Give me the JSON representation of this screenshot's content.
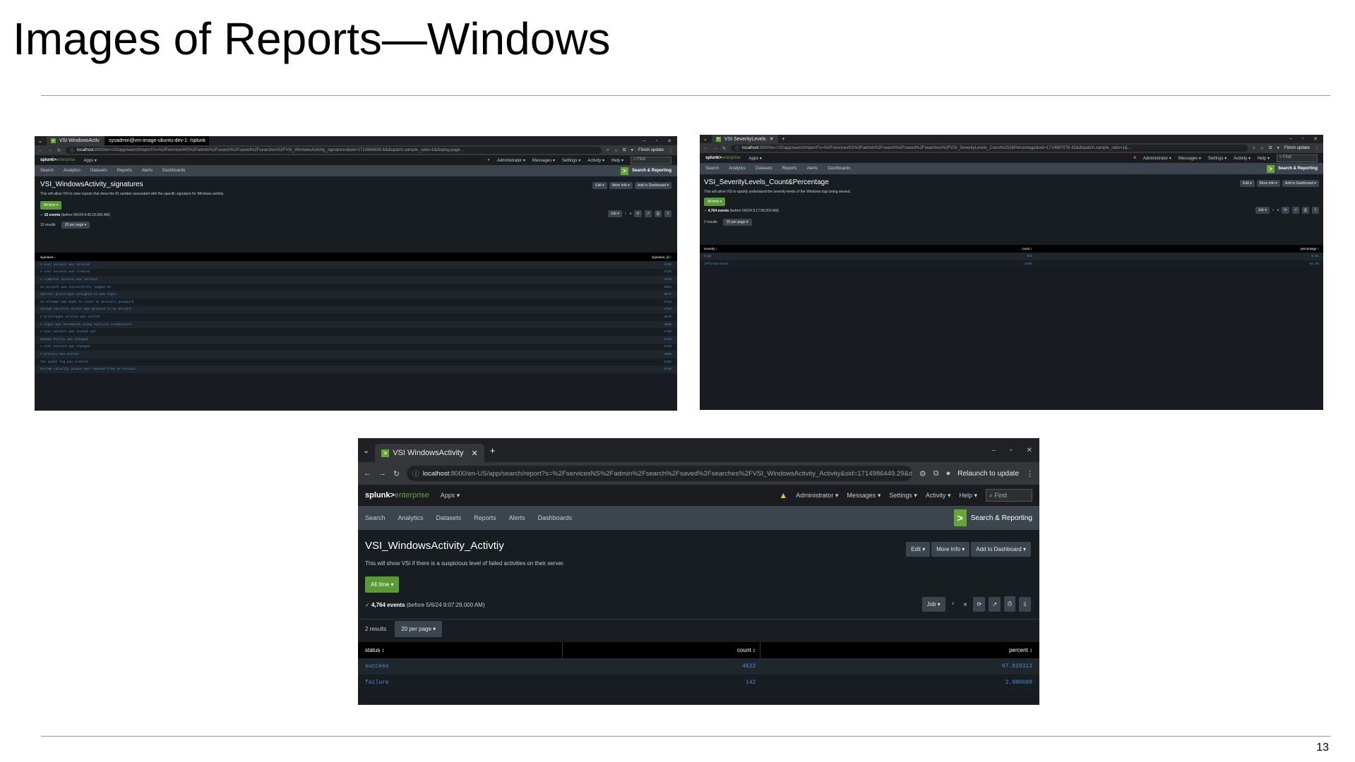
{
  "slide": {
    "title": "Images of Reports—Windows",
    "page_number": "13"
  },
  "common": {
    "finish_update": "Finish update",
    "relaunch": "Relaunch to update",
    "brand": "splunk>",
    "brand_suffix": "enterprise",
    "apps": "Apps ▾",
    "menu": [
      "Administrator ▾",
      "Messages ▾",
      "Settings ▾",
      "Activity ▾",
      "Help ▾"
    ],
    "find": "Find",
    "appnav": [
      "Search",
      "Analytics",
      "Datasets",
      "Reports",
      "Alerts",
      "Dashboards"
    ],
    "search_reporting": "Search & Reporting",
    "edit": "Edit ▾",
    "more_info": "More Info ▾",
    "add_dashboard": "Add to Dashboard ▾",
    "all_time": "All time ▾",
    "per_page": "20 per page ▾",
    "job": "Job ▾"
  },
  "shot1": {
    "tab": "VSI WindowsActiv",
    "tooltip": "sysadmin@vm-image-ubuntu-dev-1: /splunk",
    "url_host": "localhost",
    "url_rest": ":8000/en-US/app/search/report?s=%2FservicesNS%2Fadmin%2Fsearch%2Fsaved%2Fsearches%2FVSI_WindowsActivity_signatures&sid=1714984938.6&dispatch.sample_ratio=1&display.page...",
    "report_title": "VSI_WindowsActivity_signatures",
    "description": "This will allow VSI to view reports that show the ID number associated with the specific signature for Windows activity.",
    "events": "15 events",
    "events_suffix": "(before 5/6/24 8:42:18.000 AM)",
    "results": "15 results",
    "columns": [
      "signature ↕",
      "signature_id ↕"
    ],
    "rows": [
      [
        "A user account was deleted",
        "4726"
      ],
      [
        "A user account was created",
        "4720"
      ],
      [
        "A computer account was deleted",
        "4743"
      ],
      [
        "An account was successfully logged on",
        "4624"
      ],
      [
        "Special privileges assigned to new logon",
        "4672"
      ],
      [
        "An attempt was made to reset an accounts password",
        "4724"
      ],
      [
        "System security access was granted to an account",
        "4717"
      ],
      [
        "A privileged service was called",
        "4673"
      ],
      [
        "A logon was attempted using explicit credentials",
        "4648"
      ],
      [
        "A user account was locked out",
        "4740"
      ],
      [
        "Domain Policy was changed",
        "4739"
      ],
      [
        "A user account was changed",
        "4738"
      ],
      [
        "A process has exited",
        "4689"
      ],
      [
        "The audit log was cleared",
        "1102"
      ],
      [
        "System security access was removed from an account",
        "4718"
      ]
    ]
  },
  "shot2": {
    "tab": "VSI SeverityLevels",
    "url_host": "localhost",
    "url_rest": ":8000/en-US/app/search/report?s=%2FservicesNS%2Fadmin%2Fsearch%2Fsaved%2Fsearches%2FVSI_SeverityLevels_Count%2526Percentage&sid=1714987078.42&dispatch.sample_ratio=1&...",
    "report_title": "VSI_SeverityLevels_Count&Percentage",
    "description": "This will allow VSI to quickly understand the severity levels of the Windows logs being viewed.",
    "events": "4,764 events",
    "events_suffix": "(before 5/6/24 9:17:58.000 AM)",
    "results": "2 results",
    "columns": [
      "severity ↕",
      "count ↕",
      "percentage ↕"
    ],
    "rows": [
      [
        "high",
        "329",
        "6.91"
      ],
      [
        "informational",
        "4435",
        "93.09"
      ]
    ]
  },
  "shot3": {
    "tab": "VSI WindowsActivity",
    "url_host": "localhost",
    "url_rest": ":8000/en-US/app/search/report?s=%2FservicesNS%2Fadmin%2Fsearch%2Fsaved%2Fsearches%2FVSI_WindowsActivity_Activtiy&sid=1714986449.29&dispatch.sample_ratio=1&display...",
    "report_title": "VSI_WindowsActivity_Activtiy",
    "description": "This will show VSI if there is a suspicious level of failed activities on their server.",
    "events": "4,764 events",
    "events_suffix": "(before 5/6/24 9:07:29.000 AM)",
    "results": "2 results",
    "columns": [
      "status ↕",
      "count ↕",
      "percent ↕"
    ],
    "rows": [
      [
        "success",
        "4622",
        "97.019312"
      ],
      [
        "failure",
        "142",
        "2.980688"
      ]
    ]
  }
}
